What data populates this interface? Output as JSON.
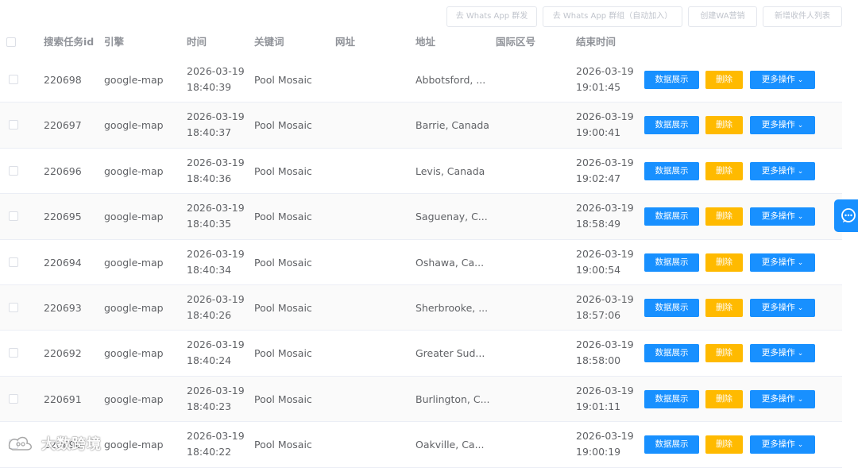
{
  "top_actions": [
    {
      "label": "去 Whats App 群发"
    },
    {
      "label": "去 Whats App 群组（自动加入）"
    },
    {
      "label": "创建WA营销"
    },
    {
      "label": "新增收件人列表"
    }
  ],
  "table": {
    "headers": {
      "task_id": "搜索任务id",
      "engine": "引擎",
      "time": "时间",
      "keyword": "关键词",
      "website": "网址",
      "address": "地址",
      "country_code": "国际区号",
      "end_time": "结束时间"
    },
    "row_actions": {
      "data_label": "数据展示",
      "delete_label": "删除",
      "more_label": "更多操作"
    },
    "rows": [
      {
        "id": "220698",
        "engine": "google-map",
        "time_date": "2026-03-19",
        "time_clock": "18:40:39",
        "keyword": "Pool Mosaic",
        "website": "",
        "address": "Abbotsford, ...",
        "country_code": "",
        "end_date": "2026-03-19",
        "end_clock": "19:01:45"
      },
      {
        "id": "220697",
        "engine": "google-map",
        "time_date": "2026-03-19",
        "time_clock": "18:40:37",
        "keyword": "Pool Mosaic",
        "website": "",
        "address": "Barrie, Canada",
        "country_code": "",
        "end_date": "2026-03-19",
        "end_clock": "19:00:41"
      },
      {
        "id": "220696",
        "engine": "google-map",
        "time_date": "2026-03-19",
        "time_clock": "18:40:36",
        "keyword": "Pool Mosaic",
        "website": "",
        "address": "Levis, Canada",
        "country_code": "",
        "end_date": "2026-03-19",
        "end_clock": "19:02:47"
      },
      {
        "id": "220695",
        "engine": "google-map",
        "time_date": "2026-03-19",
        "time_clock": "18:40:35",
        "keyword": "Pool Mosaic",
        "website": "",
        "address": "Saguenay, C...",
        "country_code": "",
        "end_date": "2026-03-19",
        "end_clock": "18:58:49"
      },
      {
        "id": "220694",
        "engine": "google-map",
        "time_date": "2026-03-19",
        "time_clock": "18:40:34",
        "keyword": "Pool Mosaic",
        "website": "",
        "address": "Oshawa, Ca...",
        "country_code": "",
        "end_date": "2026-03-19",
        "end_clock": "19:00:54"
      },
      {
        "id": "220693",
        "engine": "google-map",
        "time_date": "2026-03-19",
        "time_clock": "18:40:26",
        "keyword": "Pool Mosaic",
        "website": "",
        "address": "Sherbrooke, ...",
        "country_code": "",
        "end_date": "2026-03-19",
        "end_clock": "18:57:06"
      },
      {
        "id": "220692",
        "engine": "google-map",
        "time_date": "2026-03-19",
        "time_clock": "18:40:24",
        "keyword": "Pool Mosaic",
        "website": "",
        "address": "Greater Sud...",
        "country_code": "",
        "end_date": "2026-03-19",
        "end_clock": "18:58:00"
      },
      {
        "id": "220691",
        "engine": "google-map",
        "time_date": "2026-03-19",
        "time_clock": "18:40:23",
        "keyword": "Pool Mosaic",
        "website": "",
        "address": "Burlington, C...",
        "country_code": "",
        "end_date": "2026-03-19",
        "end_clock": "19:01:11"
      },
      {
        "id": "220690",
        "engine": "google-map",
        "time_date": "2026-03-19",
        "time_clock": "18:40:22",
        "keyword": "Pool Mosaic",
        "website": "",
        "address": "Oakville, Ca...",
        "country_code": "",
        "end_date": "2026-03-19",
        "end_clock": "19:00:19"
      }
    ]
  },
  "watermark": {
    "text": "大数跨境"
  },
  "icons": {
    "chat": "chat-bubble-icon",
    "more_chevron": "chevron-down-icon",
    "watermark_logo": "watermark-logo-icon"
  },
  "colors": {
    "primary": "#1890ff",
    "warning": "#ffba00",
    "header_text": "#909399",
    "body_text": "#606266"
  }
}
